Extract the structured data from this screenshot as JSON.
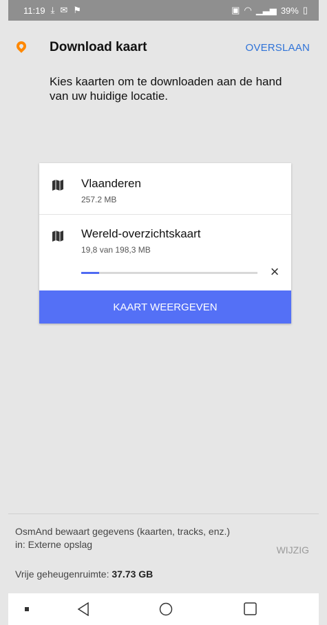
{
  "status_bar": {
    "time": "11:19",
    "battery": "39%"
  },
  "header": {
    "title": "Download kaart",
    "skip_label": "OVERSLAAN"
  },
  "description": "Kies kaarten om te downloaden aan de hand van uw huidige locatie.",
  "maps": [
    {
      "name": "Vlaanderen",
      "size": "257.2 MB",
      "icon": "map-icon"
    },
    {
      "name": "Wereld-overzichtskaart",
      "progress_text": "19,8 van 198,3 MB",
      "progress_fraction": 0.1,
      "icon": "map-icon"
    }
  ],
  "show_map_label": "KAART WEERGEVEN",
  "footer": {
    "storage_info": "OsmAnd bewaart gegevens (kaarten, tracks, enz.) in: Externe opslag",
    "change_label": "WIJZIG",
    "free_space_label": "Vrije geheugenruimte:",
    "free_space_value": "37.73 GB"
  },
  "colors": {
    "accent": "#5470f6",
    "logo": "#ff8800",
    "link": "#2f73d8"
  }
}
